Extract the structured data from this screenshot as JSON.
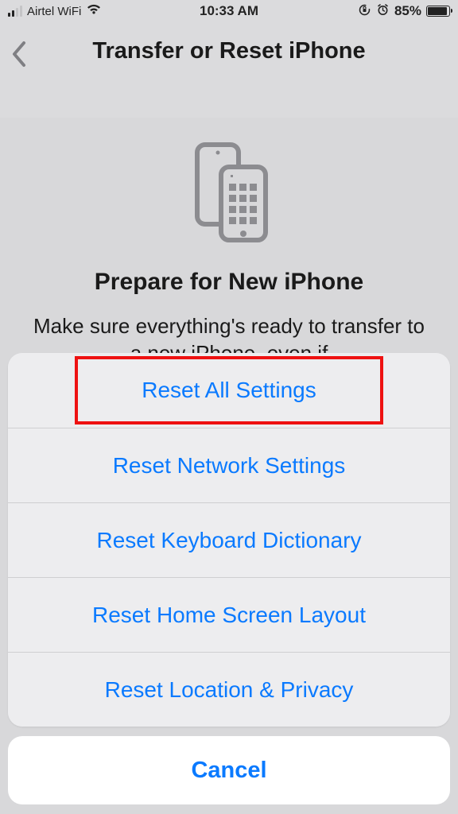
{
  "status": {
    "carrier": "Airtel WiFi",
    "time": "10:33 AM",
    "battery_pct": "85%"
  },
  "nav": {
    "title": "Transfer or Reset iPhone"
  },
  "content": {
    "heading": "Prepare for New iPhone",
    "body": "Make sure everything's ready to transfer to a new iPhone, even if"
  },
  "sheet": {
    "options": [
      {
        "label": "Reset All Settings"
      },
      {
        "label": "Reset Network Settings"
      },
      {
        "label": "Reset Keyboard Dictionary"
      },
      {
        "label": "Reset Home Screen Layout"
      },
      {
        "label": "Reset Location & Privacy"
      }
    ],
    "cancel": "Cancel"
  }
}
